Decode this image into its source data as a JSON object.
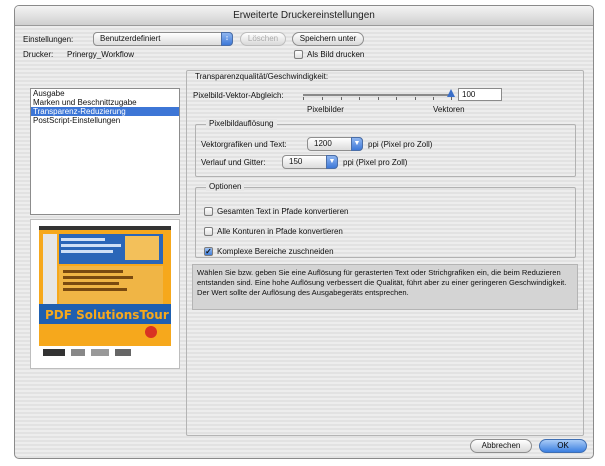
{
  "window": {
    "title": "Erweiterte Druckereinstellungen"
  },
  "settings": {
    "label": "Einstellungen:",
    "value": "Benutzerdefiniert",
    "delete_label": "Löschen",
    "save_label": "Speichern unter"
  },
  "printer": {
    "label": "Drucker:",
    "value": "Prinergy_Workflow",
    "print_as_image_label": "Als Bild drucken",
    "print_as_image_checked": false
  },
  "sidebar": {
    "items": [
      {
        "label": "Ausgabe",
        "selected": false
      },
      {
        "label": "Marken und Beschnittzugabe",
        "selected": false
      },
      {
        "label": "Transparenz-Reduzierung",
        "selected": true
      },
      {
        "label": "PostScript-Einstellungen",
        "selected": false
      }
    ],
    "preview": {
      "headline": "PDF SolutionsTour",
      "colors": {
        "orange": "#f6a81c",
        "blue": "#1f5fb0",
        "red": "#d93322"
      }
    }
  },
  "transparency": {
    "section_title": "Transparenzqualität/Geschwindigkeit:",
    "slider_label": "Pixelbild-Vektor-Abgleich:",
    "slider_value": 100,
    "slider_value_text": "100",
    "left_end_label": "Pixelbilder",
    "right_end_label": "Vektoren"
  },
  "resolution": {
    "title": "Pixelbildauflösung",
    "vector_label": "Vektorgrafiken und Text:",
    "vector_value": "1200",
    "vector_unit": "ppi (Pixel pro Zoll)",
    "gradient_label": "Verlauf und Gitter:",
    "gradient_value": "150",
    "gradient_unit": "ppi (Pixel pro Zoll)"
  },
  "options": {
    "title": "Optionen",
    "items": [
      {
        "label": "Gesamten Text in Pfade konvertieren",
        "checked": false
      },
      {
        "label": "Alle Konturen in Pfade konvertieren",
        "checked": false
      },
      {
        "label": "Komplexe Bereiche zuschneiden",
        "checked": true
      }
    ]
  },
  "description": "Wählen Sie bzw. geben Sie eine Auflösung für gerasterten Text oder Strichgrafiken ein, die beim Reduzieren entstanden sind. Eine hohe Auflösung verbessert die Qualität, führt aber zu einer geringeren Geschwindigkeit. Der Wert sollte der Auflösung des Ausgabegeräts entsprechen.",
  "footer": {
    "cancel_label": "Abbrechen",
    "ok_label": "OK"
  }
}
